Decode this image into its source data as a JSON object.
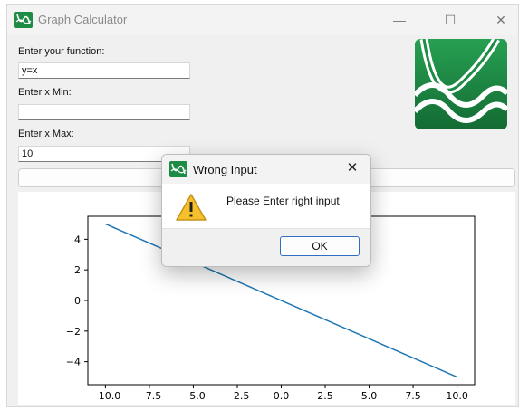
{
  "window": {
    "title": "Graph Calculator",
    "controls": {
      "minimize": "—",
      "maximize": "☐",
      "close": "✕"
    }
  },
  "form": {
    "function_label": "Enter your function:",
    "function_value": "y=x",
    "xmin_label": "Enter x Min:",
    "xmin_value": "",
    "xmax_label": "Enter x Max:",
    "xmax_value": "10"
  },
  "colors": {
    "brand_green": "#1e8c45",
    "line_blue": "#1f77b4",
    "accent_blue": "#2f6fbf",
    "warning_yellow": "#f4c430"
  },
  "dialog": {
    "title": "Wrong Input",
    "message": "Please Enter right input",
    "ok_label": "OK",
    "close_glyph": "✕",
    "icon": "warning-icon"
  },
  "chart_data": {
    "type": "line",
    "title": "",
    "xlabel": "",
    "ylabel": "",
    "xlim": [
      -11,
      11
    ],
    "ylim": [
      -5.5,
      5.5
    ],
    "grid": false,
    "x": [
      -10,
      10
    ],
    "y": [
      5,
      -5
    ],
    "xticks": [
      -10.0,
      -7.5,
      -5.0,
      -2.5,
      0.0,
      2.5,
      5.0,
      7.5,
      10.0
    ],
    "xtick_labels": [
      "−10.0",
      "−7.5",
      "−5.0",
      "−2.5",
      "0.0",
      "2.5",
      "5.0",
      "7.5",
      "10.0"
    ],
    "yticks": [
      4,
      2,
      0,
      -2,
      -4
    ],
    "ytick_labels": [
      "4",
      "2",
      "0",
      "−2",
      "−4"
    ]
  }
}
